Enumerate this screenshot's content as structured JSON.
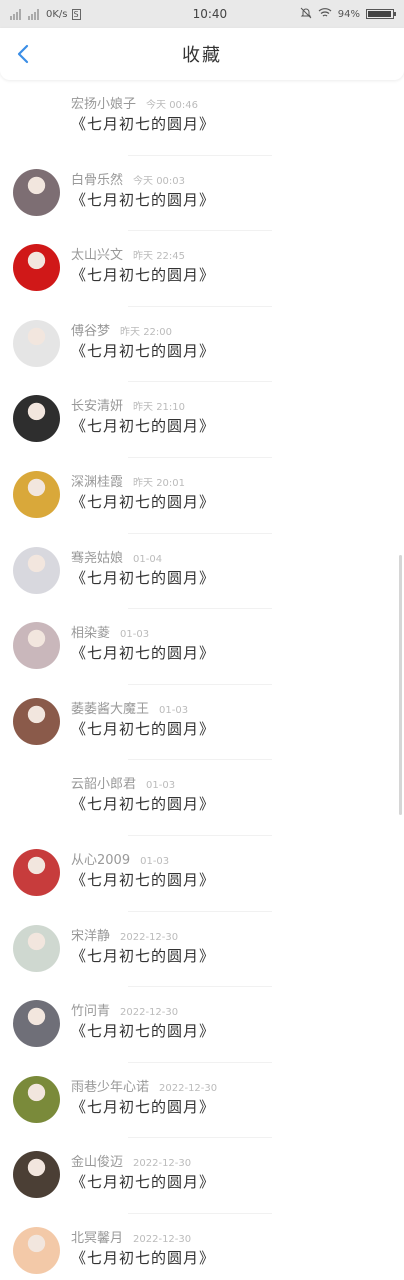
{
  "status_bar": {
    "network_speed": "0K/s",
    "sim_badge": "S",
    "time": "10:40",
    "battery": "94%"
  },
  "header": {
    "title": "收藏"
  },
  "items": [
    {
      "name": "宏扬小娘子",
      "time": "今天 00:46",
      "book": "《七月初七的圆月》",
      "avatar": "none"
    },
    {
      "name": "白骨乐然",
      "time": "今天 00:03",
      "book": "《七月初七的圆月》",
      "avatar": "#7d6e73"
    },
    {
      "name": "太山兴文",
      "time": "昨天 22:45",
      "book": "《七月初七的圆月》",
      "avatar": "#d01818"
    },
    {
      "name": "傅谷梦",
      "time": "昨天 22:00",
      "book": "《七月初七的圆月》",
      "avatar": "#e5e5e5"
    },
    {
      "name": "长安清妍",
      "time": "昨天 21:10",
      "book": "《七月初七的圆月》",
      "avatar": "#2e2e2e"
    },
    {
      "name": "深渊桂霞",
      "time": "昨天 20:01",
      "book": "《七月初七的圆月》",
      "avatar": "#d9a83a"
    },
    {
      "name": "骞尧姑娘",
      "time": "01-04",
      "book": "《七月初七的圆月》",
      "avatar": "#d8d8de"
    },
    {
      "name": "相染菱",
      "time": "01-03",
      "book": "《七月初七的圆月》",
      "avatar": "#c9b7bb"
    },
    {
      "name": "萎萎酱大魔王",
      "time": "01-03",
      "book": "《七月初七的圆月》",
      "avatar": "#8a5a4a"
    },
    {
      "name": "云韶小郎君",
      "time": "01-03",
      "book": "《七月初七的圆月》",
      "avatar": "none"
    },
    {
      "name": "从心2009",
      "time": "01-03",
      "book": "《七月初七的圆月》",
      "avatar": "#c73c3c"
    },
    {
      "name": "宋洋静",
      "time": "2022-12-30",
      "book": "《七月初七的圆月》",
      "avatar": "#cfd8d0"
    },
    {
      "name": "竹问青",
      "time": "2022-12-30",
      "book": "《七月初七的圆月》",
      "avatar": "#6f6f78"
    },
    {
      "name": "雨巷少年心诺",
      "time": "2022-12-30",
      "book": "《七月初七的圆月》",
      "avatar": "#7a8a3a"
    },
    {
      "name": "金山俊迈",
      "time": "2022-12-30",
      "book": "《七月初七的圆月》",
      "avatar": "#4b3f35"
    },
    {
      "name": "北冥馨月",
      "time": "2022-12-30",
      "book": "《七月初七的圆月》",
      "avatar": "#f3c9a8"
    }
  ]
}
